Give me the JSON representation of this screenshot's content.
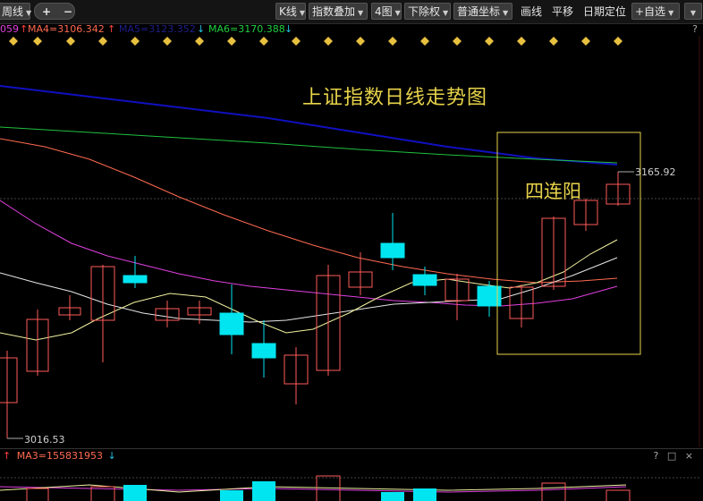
{
  "toolbar": {
    "period_label": "周线",
    "add_btn": "+",
    "remove_btn": "−",
    "kline_btn": "K线",
    "index_overlay_btn": "指数叠加",
    "four_charts_btn": "4图",
    "adjust_btn": "下除权",
    "coord_btn": "普通坐标",
    "draw_line_btn": "画线",
    "pan_btn": "平移",
    "date_locate_btn": "日期定位",
    "watchlist_btn": "+自选"
  },
  "legend": {
    "ma3_partial": "059",
    "ma4": "MA4=3106.342",
    "ma5_hidden": "MA5=3123.352",
    "ma6": "MA6=3170.388",
    "up_arrow": "↑",
    "down_arrow": "↓",
    "help": "?"
  },
  "chart": {
    "title": "上证指数日线走势图",
    "pattern_label": "四连阳",
    "high_label": "3165.92",
    "low_label": "3016.53",
    "colors": {
      "up": "#ff5a5a",
      "down": "#00e5f0",
      "ma_yellow": "#f2f2a0",
      "ma_white": "#e6e6e6",
      "ma_magenta": "#e040e0",
      "ma_red": "#ff6a50",
      "ma_green": "#20c040",
      "ma_blue": "#1010c0",
      "highlight_box": "#e8d44a"
    }
  },
  "volume": {
    "ma3_label": "MA3=155831953",
    "up_arrow": "↑",
    "down_arrow": "↓",
    "controls": "? □ ×"
  }
}
